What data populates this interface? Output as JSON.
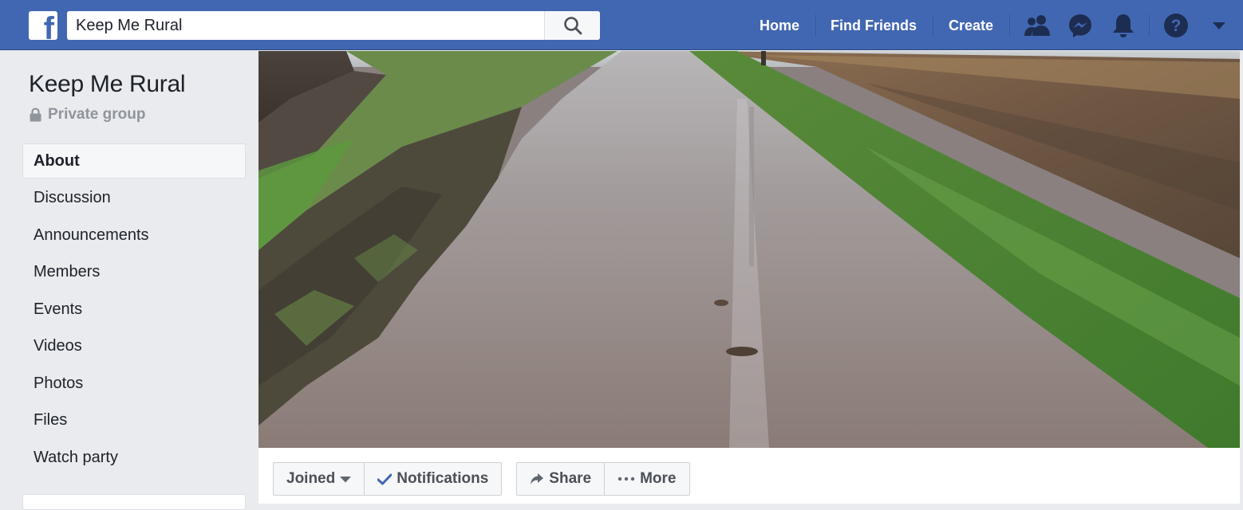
{
  "search": {
    "value": "Keep Me Rural"
  },
  "nav": {
    "home": "Home",
    "find_friends": "Find Friends",
    "create": "Create"
  },
  "group": {
    "name": "Keep Me Rural",
    "privacy": "Private group"
  },
  "sidebar": {
    "items": [
      {
        "label": "About"
      },
      {
        "label": "Discussion"
      },
      {
        "label": "Announcements"
      },
      {
        "label": "Members"
      },
      {
        "label": "Events"
      },
      {
        "label": "Videos"
      },
      {
        "label": "Photos"
      },
      {
        "label": "Files"
      },
      {
        "label": "Watch party"
      }
    ],
    "active": "About"
  },
  "actions": {
    "joined": "Joined",
    "notifications": "Notifications",
    "share": "Share",
    "more": "More"
  },
  "icons": {
    "logo": "facebook-logo",
    "search": "search-icon",
    "friends": "friends-icon",
    "messenger": "messenger-icon",
    "notifications": "bell-icon",
    "help": "help-icon",
    "account_menu": "caret-down-icon"
  },
  "colors": {
    "brand": "#4267b2",
    "check": "#4267b2"
  }
}
